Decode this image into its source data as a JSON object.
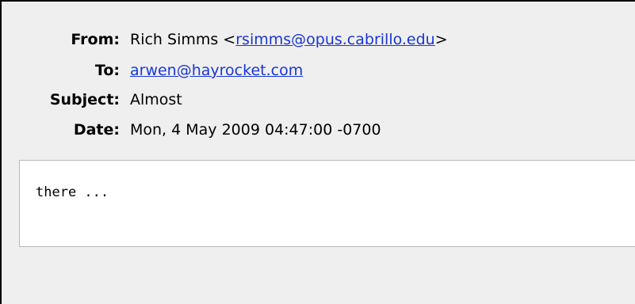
{
  "headers": {
    "from_label": "From:",
    "from_name": "Rich Simms <",
    "from_email": "rsimms@opus.cabrillo.edu",
    "from_close": ">",
    "to_label": "To:",
    "to_email": "arwen@hayrocket.com",
    "subject_label": "Subject:",
    "subject_value": "Almost",
    "date_label": "Date:",
    "date_value": "Mon, 4 May 2009 04:47:00 -0700"
  },
  "body": {
    "text": "there ..."
  },
  "colors": {
    "link": "#1a36d6",
    "background": "#efefef",
    "body_background": "#ffffff"
  }
}
